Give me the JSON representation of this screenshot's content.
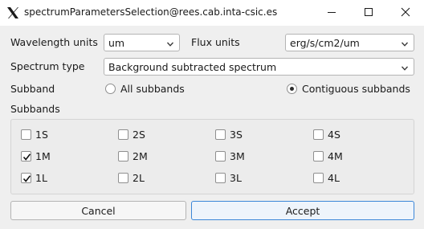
{
  "window": {
    "title": "spectrumParametersSelection@rees.cab.inta-csic.es"
  },
  "wavelength": {
    "label": "Wavelength units",
    "value": "um"
  },
  "flux": {
    "label": "Flux units",
    "value": "erg/s/cm2/um"
  },
  "spectrum_type": {
    "label": "Spectrum type",
    "value": "Background subtracted spectrum"
  },
  "subband": {
    "label": "Subband",
    "options": [
      "All subbands",
      "Contiguous subbands"
    ],
    "selected": "Contiguous subbands"
  },
  "subbands": {
    "label": "Subbands",
    "rows": [
      [
        {
          "label": "1S",
          "checked": false
        },
        {
          "label": "2S",
          "checked": false
        },
        {
          "label": "3S",
          "checked": false
        },
        {
          "label": "4S",
          "checked": false
        }
      ],
      [
        {
          "label": "1M",
          "checked": true
        },
        {
          "label": "2M",
          "checked": false
        },
        {
          "label": "3M",
          "checked": false
        },
        {
          "label": "4M",
          "checked": false
        }
      ],
      [
        {
          "label": "1L",
          "checked": true
        },
        {
          "label": "2L",
          "checked": false
        },
        {
          "label": "3L",
          "checked": false
        },
        {
          "label": "4L",
          "checked": false
        }
      ]
    ]
  },
  "buttons": {
    "cancel": "Cancel",
    "accept": "Accept"
  },
  "icons": {
    "app": "x-logo-icon",
    "minimize": "minimize-icon",
    "maximize": "maximize-icon",
    "close": "close-icon"
  }
}
